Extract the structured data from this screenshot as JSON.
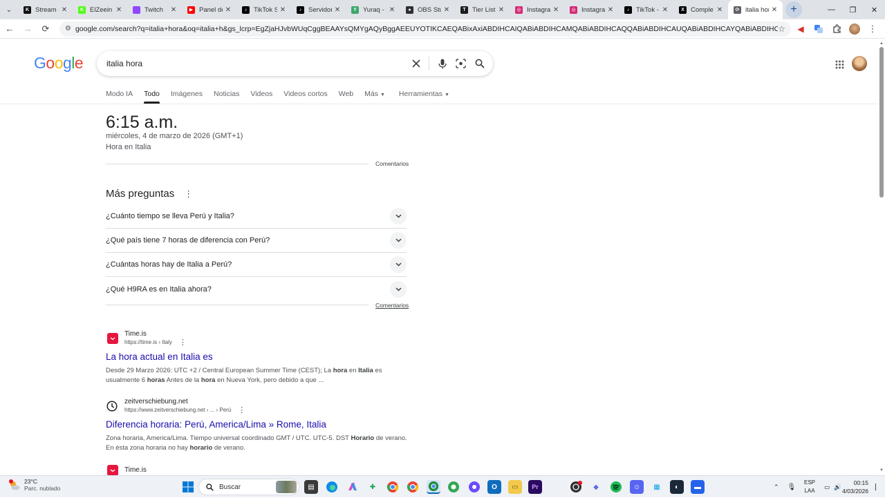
{
  "browser": {
    "tabs": [
      {
        "title": "Stream -",
        "color": "#0f0f0f",
        "glyph": "K"
      },
      {
        "title": "ElZeein S",
        "color": "#53fc18",
        "glyph": "K"
      },
      {
        "title": "Twitch",
        "color": "#9146ff",
        "glyph": ""
      },
      {
        "title": "Panel de",
        "color": "#ff0000",
        "glyph": "▶"
      },
      {
        "title": "TikTok S",
        "color": "#000000",
        "glyph": "♪"
      },
      {
        "title": "Servidor",
        "color": "#000000",
        "glyph": "♪"
      },
      {
        "title": "Yuraq - F",
        "color": "#3da66b",
        "glyph": "Y"
      },
      {
        "title": "OBS Stud",
        "color": "#302e31",
        "glyph": "●"
      },
      {
        "title": "Tier List",
        "color": "#1c1c1c",
        "glyph": "T"
      },
      {
        "title": "Instagra",
        "color": "#d62976",
        "glyph": "◎"
      },
      {
        "title": "Instagra",
        "color": "#d62976",
        "glyph": "◎"
      },
      {
        "title": "TikTok -",
        "color": "#000000",
        "glyph": "♪"
      },
      {
        "title": "Comple",
        "color": "#000000",
        "glyph": "X"
      },
      {
        "title": "italia hor",
        "color": "#5f6368",
        "glyph": "⟳"
      }
    ],
    "url": "google.com/search?q=italia+hora&oq=italia+h&gs_lcrp=EgZjaHJvbWUqCggBEAAYsQMYgAQyBggAEEUYOTIKCAEQABixAxiABDIHCAIQABiABDIHCAMQABiABDIHCAQQABiABDIHCAUQABiABDIHCAYQABiABDIHCAcQABiABDIHCAgQABiABDIHC..."
  },
  "google": {
    "logo": [
      "G",
      "o",
      "o",
      "g",
      "l",
      "e"
    ],
    "logo_colors": [
      "#4285f4",
      "#ea4335",
      "#fbbc05",
      "#4285f4",
      "#34a853",
      "#ea4335"
    ],
    "query": "italia hora",
    "tabs": [
      "Modo IA",
      "Todo",
      "Imágenes",
      "Noticias",
      "Videos",
      "Videos cortos",
      "Web",
      "Más",
      "Herramientas"
    ]
  },
  "time_card": {
    "time": "6:15 a.m.",
    "date": "miércoles, 4 de marzo de 2026 (GMT+1)",
    "place": "Hora en Italia",
    "feedback": "Comentarios"
  },
  "paa": {
    "title": "Más preguntas",
    "questions": [
      "¿Cuánto tiempo se lleva Perú y Italia?",
      "¿Qué país tiene 7 horas de diferencia con Perú?",
      "¿Cuántas horas hay de Italia a Perú?",
      "¿Qué H9RA es en Italia ahora?"
    ],
    "feedback": "Comentarios"
  },
  "results": [
    {
      "site": "Time.is",
      "cite": "https://time.is › Italy",
      "title": "La hora actual en Italia es",
      "snippet_html": "Desde 29 Marzo 2026: UTC +2 / Central European Summer Time (CEST); La <b>hora</b> en <b>Italia</b> es usualmente 6 <b>horas</b> Antes de la <b>hora</b> en Nueva York, pero debido a que ..."
    },
    {
      "site": "zeitverschiebung.net",
      "cite": "https://www.zeitverschiebung.net › ... › Perú",
      "title": "Diferencia horaria: Perú, America/Lima » Rome, Italia",
      "snippet_html": "Zona horaria, America/Lima. Tiempo universal coordinado GMT / UTC. UTC-5. DST <b>Horario</b> de verano.<br>En ésta zona horaria no hay <b>horario</b> de verano."
    },
    {
      "site": "Time.is",
      "cite": "",
      "title": "",
      "snippet_html": ""
    }
  ],
  "taskbar": {
    "weather_temp": "23°C",
    "weather_cond": "Parc. nublado",
    "search_label": "Buscar",
    "lang_top": "ESP",
    "lang_bottom": "LAA",
    "clock_time": "00:15",
    "clock_date": "4/03/2026"
  }
}
